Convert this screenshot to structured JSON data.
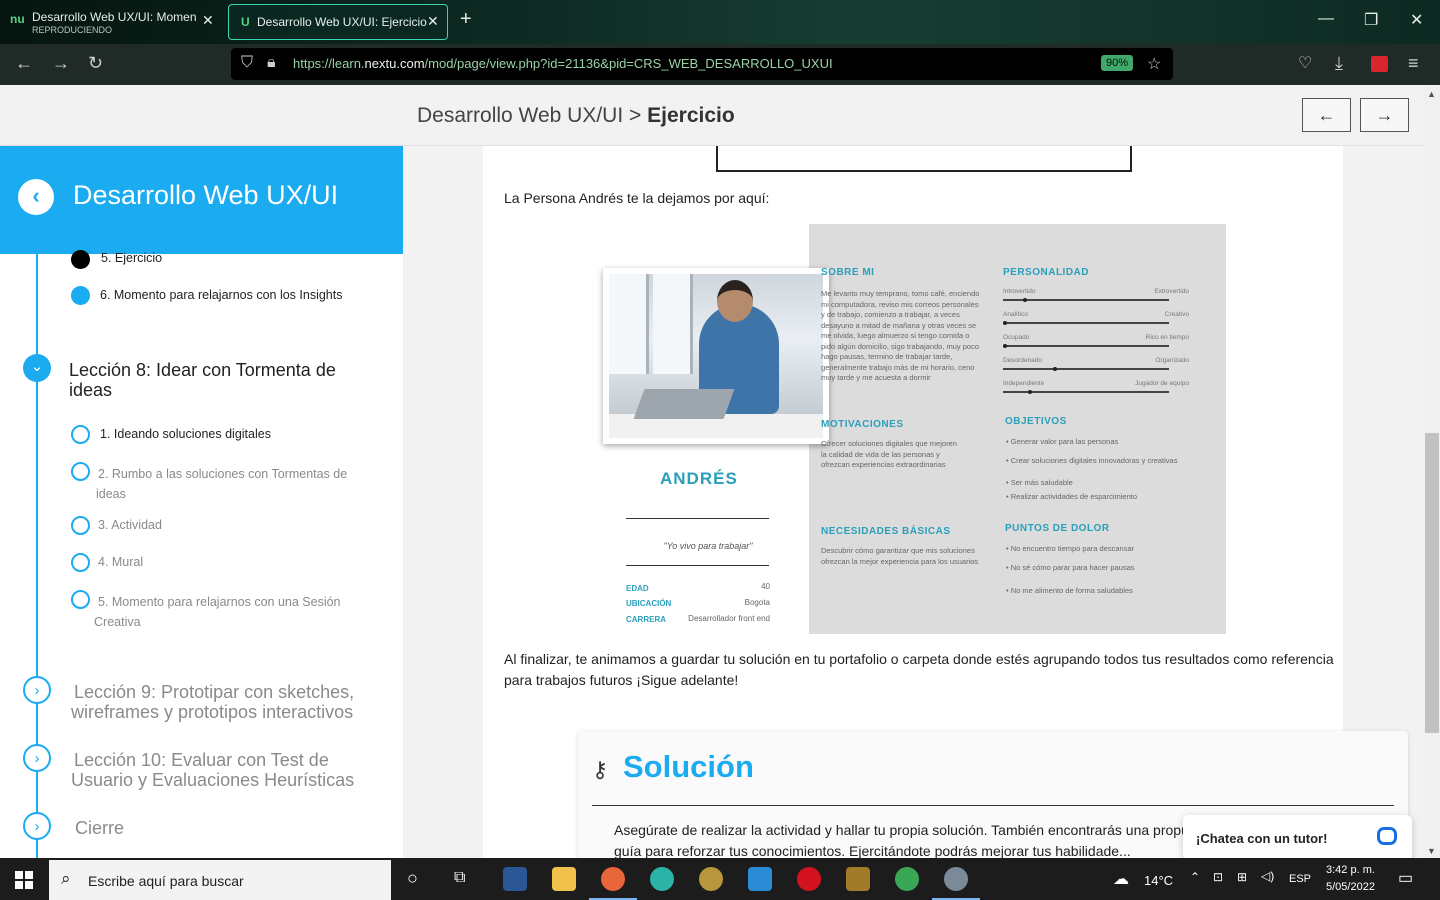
{
  "browser": {
    "tabs": [
      {
        "title": "Desarrollo Web UX/UI: Momento",
        "subtitle": "REPRODUCIENDO",
        "favicon": "nu"
      },
      {
        "title": "Desarrollo Web UX/UI: Ejercicio",
        "favicon": "U"
      }
    ],
    "url_prefix": "https://learn.",
    "url_domain": "nextu.com",
    "url_path": "/mod/page/view.php?id=21136&pid=CRS_WEB_DESARROLLO_UXUI",
    "zoom": "90%"
  },
  "header": {
    "crumb_parent": "Desarrollo Web UX/UI",
    "crumb_sep": ">",
    "crumb_current": "Ejercicio",
    "prev_label": "←",
    "next_label": "→"
  },
  "sidebar": {
    "back_label": "‹",
    "title": "Desarrollo Web UX/UI",
    "steps_top": [
      {
        "label": "5. Ejercicio"
      },
      {
        "label": "6. Momento para relajarnos con los Insights"
      }
    ],
    "lesson8": {
      "title": "Lección 8: Idear con Tormenta de ideas",
      "items": [
        "1. Ideando soluciones digitales",
        "2. Rumbo a las soluciones con Tormentas de ideas",
        "3. Actividad",
        "4. Mural",
        "5. Momento para relajarnos con una Sesión Creativa"
      ]
    },
    "lesson9": "Lección 9: Prototipar con sketches, wireframes y prototipos interactivos",
    "lesson10": "Lección 10: Evaluar con Test de Usuario y Evaluaciones Heurísticas",
    "cierre": "Cierre"
  },
  "content": {
    "persona_intro": "La Persona Andrés te la dejamos por aquí:",
    "persona": {
      "name": "ANDRÉS",
      "quote": "\"Yo vivo para trabajar\"",
      "edad_label": "EDAD",
      "edad": "40",
      "ubicacion_label": "UBICACIÓN",
      "ubicacion": "Bogota",
      "carrera_label": "CARRERA",
      "carrera": "Desarrollador front end",
      "sobre_mi_title": "SOBRE MI",
      "sobre_mi": "Me levanto muy temprano, tomo café, enciendo mi computadora, reviso mis correos personales y de trabajo, comienzo a trabajar, a veces desayuno a mitad de mañana y otras veces se me olvida, luego almuerzo si tengo comida o pido algún domicilio, sigo trabajando, muy poco hago pausas, termino de trabajar tarde, generalmente trabajo más de mi horario, ceno muy tarde y me acuesta a dormir",
      "motivaciones_title": "MOTIVACIONES",
      "motivaciones": "Ofrecer soluciones digitales que mejoren la calidad de vida de las personas y ofrezcan experiencias extraordinarias",
      "necesidades_title": "NECESIDADES BÁSICAS",
      "necesidades": "Descubrir cómo garantizar que mis soluciones ofrezcan la mejor experiencia para los usuarios",
      "personalidad_title": "PERSONALIDAD",
      "personalidad": [
        {
          "left": "Introvertido",
          "right": "Extrovertido",
          "value": 0.12
        },
        {
          "left": "Analítico",
          "right": "Creativo",
          "value": 0.0
        },
        {
          "left": "Ocupado",
          "right": "Rico en tiempo",
          "value": 0.0
        },
        {
          "left": "Desordenado",
          "right": "Organizado",
          "value": 0.3
        },
        {
          "left": "Independiente",
          "right": "Jugador de equipo",
          "value": 0.15
        }
      ],
      "objetivos_title": "OBJETIVOS",
      "objetivos": [
        "Generar valor para las personas",
        "Crear soluciones digitales innovadoras y creativas",
        "Ser más saludable",
        "Realizar actividades de esparcimiento"
      ],
      "dolor_title": "PUNTOS DE DOLOR",
      "dolor": [
        "No encuentro tiempo para descansar",
        "No sé cómo parar para hacer pausas",
        "No me alimento de forma saludables"
      ]
    },
    "final_text": "Al finalizar, te animamos a guardar tu solución en tu portafolio o carpeta donde estés agrupando todos tus resultados como referencia para trabajos futuros  ¡Sigue adelante!",
    "solucion_title": "Solución",
    "solucion_text": "Asegúrate de realizar la actividad y hallar tu propia solución. También encontrarás una propuesta d... ofrecemos como guía para reforzar tus conocimientos. Ejercitándote podrás mejorar tus habilidade..."
  },
  "chat": {
    "label": "¡Chatea con un tutor!"
  },
  "taskbar": {
    "search_placeholder": "Escribe aquí para buscar",
    "temp": "14°C",
    "lang": "ESP",
    "time": "3:42 p. m.",
    "date": "5/05/2022"
  }
}
